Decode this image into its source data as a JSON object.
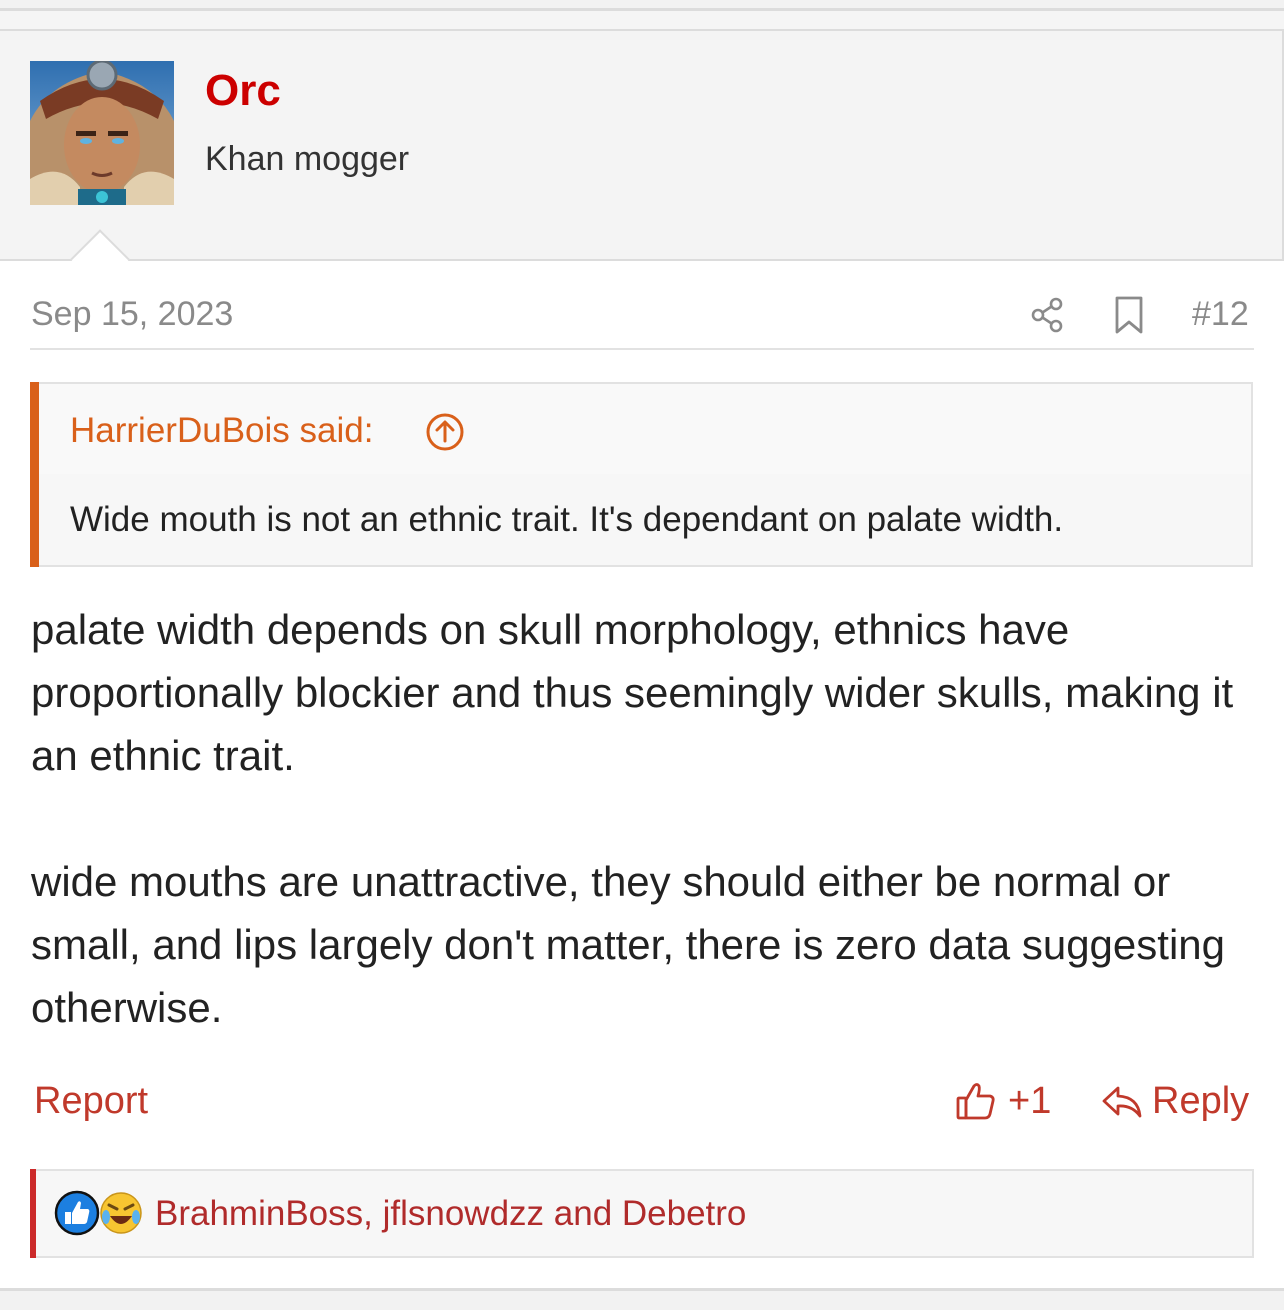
{
  "user": {
    "name": "Orc",
    "title": "Khan mogger"
  },
  "post": {
    "date": "Sep 15, 2023",
    "number": "#12",
    "quote": {
      "author": "HarrierDuBois said:",
      "text": "Wide mouth is not an ethnic trait. It's dependant on palate width."
    },
    "paragraphs": [
      "palate width depends on skull morphology, ethnics have proportionally blockier and thus seemingly wider skulls, making it an ethnic trait.",
      "wide mouths are unattractive, they should either be normal or small, and lips largely don't matter, there is zero data suggesting otherwise."
    ]
  },
  "actions": {
    "report": "Report",
    "like_count": "+1",
    "reply": "Reply"
  },
  "reactions": {
    "users": "BrahminBoss, jflsnowdzz and Debetro"
  },
  "icons": {
    "share": "share-icon",
    "bookmark": "bookmark-icon",
    "quote_jump": "arrow-up-circle-icon",
    "like": "thumbs-up-icon",
    "reply": "reply-arrow-icon"
  },
  "colors": {
    "username": "#cc0000",
    "quote_accent": "#d9601a",
    "link": "#c0392b",
    "reaction_bar": "#cc2a2a"
  }
}
